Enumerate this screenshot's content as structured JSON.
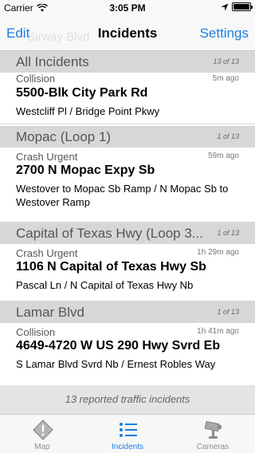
{
  "status_bar": {
    "carrier": "Carrier",
    "time": "3:05 PM"
  },
  "nav": {
    "left_button": "Edit",
    "title": "Incidents",
    "right_button": "Settings",
    "ghost_text": "Sirway Blvd"
  },
  "sections": [
    {
      "title": "All Incidents",
      "count": "13 of 13",
      "row": {
        "type": "Collision",
        "time": "5m ago",
        "address": "5500-Blk City Park Rd",
        "cross": "Westcliff Pl / Bridge Point Pkwy"
      }
    },
    {
      "title": "Mopac (Loop 1)",
      "count": "1 of 13",
      "row": {
        "type": "Crash Urgent",
        "time": "59m ago",
        "address": "2700 N Mopac Expy Sb",
        "cross": "Westover to Mopac Sb Ramp / N Mopac Sb to Westover Ramp"
      }
    },
    {
      "title": "Capital of Texas Hwy (Loop 3...",
      "count": "1 of 13",
      "row": {
        "type": "Crash Urgent",
        "time": "1h 29m ago",
        "address": "1106 N Capital of Texas Hwy Sb",
        "cross": "Pascal Ln / N Capital of Texas Hwy Nb"
      }
    },
    {
      "title": "Lamar Blvd",
      "count": "1 of 13",
      "row": {
        "type": "Collision",
        "time": "1h 41m ago",
        "address": "4649-4720 W US 290 Hwy Svrd Eb",
        "cross": "S Lamar Blvd Svrd Nb / Ernest Robles Way"
      }
    }
  ],
  "footer": "13 reported traffic incidents",
  "tabs": [
    {
      "label": "Map",
      "icon": "warning-sign-icon",
      "active": false
    },
    {
      "label": "Incidents",
      "icon": "list-icon",
      "active": true
    },
    {
      "label": "Cameras",
      "icon": "camera-icon",
      "active": false
    }
  ],
  "colors": {
    "accent": "#1a7ee0",
    "section_bg": "#d7d7d9",
    "bar_bg": "#f8f8f8"
  }
}
